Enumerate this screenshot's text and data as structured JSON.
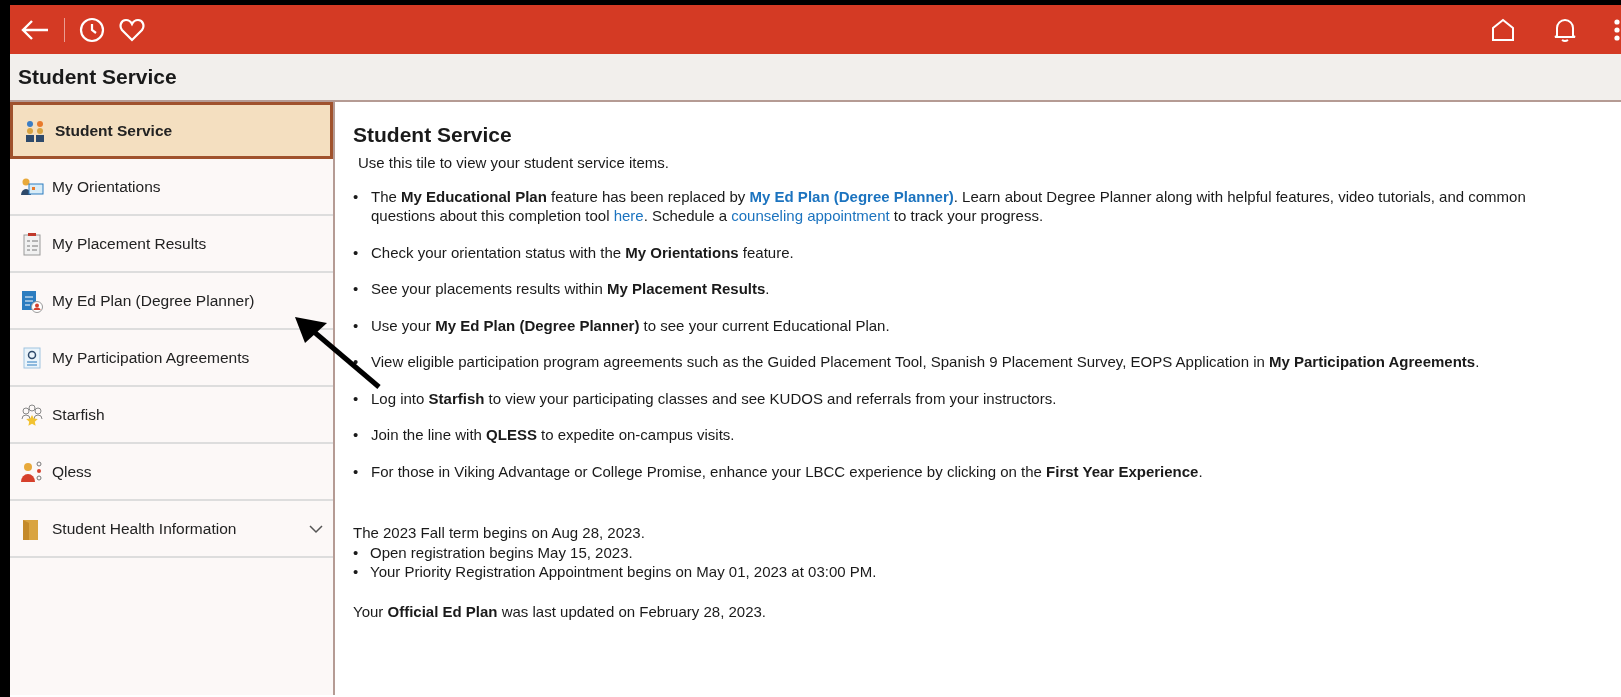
{
  "page_title": "Student Service",
  "sidebar": {
    "items": [
      {
        "label": "Student Service",
        "selected": true,
        "kind": "link"
      },
      {
        "label": "My Orientations",
        "selected": false,
        "kind": "link"
      },
      {
        "label": "My Placement Results",
        "selected": false,
        "kind": "link"
      },
      {
        "label": "My Ed Plan (Degree Planner)",
        "selected": false,
        "kind": "link"
      },
      {
        "label": "My Participation Agreements",
        "selected": false,
        "kind": "link"
      },
      {
        "label": "Starfish",
        "selected": false,
        "kind": "link"
      },
      {
        "label": "Qless",
        "selected": false,
        "kind": "link"
      },
      {
        "label": "Student Health Information",
        "selected": false,
        "kind": "group",
        "expanded": false
      }
    ]
  },
  "content": {
    "title": "Student Service",
    "intro": "Use this tile to view your student service items.",
    "bullet_marker": "•",
    "bullets": [
      {
        "parts": [
          {
            "kind": "plain",
            "text": "The "
          },
          {
            "kind": "bold",
            "text": "My Educational Plan"
          },
          {
            "kind": "plain",
            "text": " feature has been replaced by "
          },
          {
            "kind": "bold_link",
            "text": "My Ed Plan (Degree Planner)"
          },
          {
            "kind": "plain",
            "text": ". Learn about Degree Planner along with helpful features, video tutorials, and common questions about this completion tool "
          },
          {
            "kind": "link",
            "text": "here"
          },
          {
            "kind": "plain",
            "text": ". Schedule a "
          },
          {
            "kind": "link",
            "text": "counseling appointment"
          },
          {
            "kind": "plain",
            "text": " to track your progress."
          }
        ]
      },
      {
        "parts": [
          {
            "kind": "plain",
            "text": "Check your orientation status with the "
          },
          {
            "kind": "bold",
            "text": "My Orientations"
          },
          {
            "kind": "plain",
            "text": " feature."
          }
        ]
      },
      {
        "parts": [
          {
            "kind": "plain",
            "text": "See your placements results within "
          },
          {
            "kind": "bold",
            "text": "My Placement Results"
          },
          {
            "kind": "plain",
            "text": "."
          }
        ]
      },
      {
        "parts": [
          {
            "kind": "plain",
            "text": "Use your "
          },
          {
            "kind": "bold",
            "text": "My Ed Plan (Degree Planner)"
          },
          {
            "kind": "plain",
            "text": "  to see your current Educational Plan."
          }
        ]
      },
      {
        "parts": [
          {
            "kind": "plain",
            "text": "View eligible participation program agreements such as the Guided Placement Tool, Spanish 9 Placement Survey, EOPS Application in "
          },
          {
            "kind": "bold",
            "text": "My Participation Agreements"
          },
          {
            "kind": "plain",
            "text": "."
          }
        ]
      },
      {
        "parts": [
          {
            "kind": "plain",
            "text": "Log into "
          },
          {
            "kind": "bold",
            "text": "Starfish"
          },
          {
            "kind": "plain",
            "text": " to view your participating classes and see KUDOS and referrals from your instructors."
          }
        ]
      },
      {
        "parts": [
          {
            "kind": "plain",
            "text": "Join the line with "
          },
          {
            "kind": "bold",
            "text": "QLESS"
          },
          {
            "kind": "plain",
            "text": " to expedite on-campus visits."
          }
        ]
      },
      {
        "parts": [
          {
            "kind": "plain",
            "text": "For those in Viking Advantage or College Promise, enhance your LBCC experience by clicking on the "
          },
          {
            "kind": "bold",
            "text": "First Year Experience"
          },
          {
            "kind": "plain",
            "text": "."
          }
        ]
      }
    ],
    "term_note": "The 2023 Fall term begins on Aug 28, 2023.",
    "dates": [
      "Open registration begins May 15, 2023.",
      "Your Priority Registration Appointment begins on May 01, 2023 at 03:00 PM."
    ],
    "ed_plan_note": "Your **Official Ed Plan** was last updated on February 28, 2023."
  }
}
